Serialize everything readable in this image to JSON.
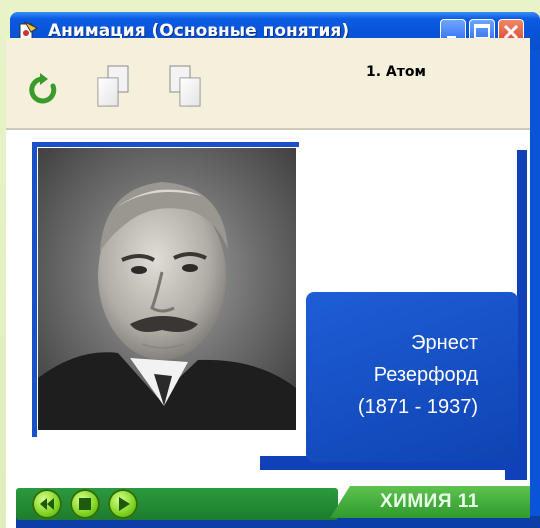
{
  "window": {
    "title": "Анимация (Основные понятия)"
  },
  "toolbar": {
    "slide_title": "1. Атом",
    "buttons": [
      {
        "icon": "refresh-icon"
      },
      {
        "icon": "page-left-icon"
      },
      {
        "icon": "page-right-icon"
      }
    ]
  },
  "slide": {
    "caption_lines": [
      "Эрнест",
      "Резерфорд",
      "(1871 - 1937)"
    ]
  },
  "footer": {
    "nav_buttons": [
      "rewind-icon",
      "stop-icon",
      "play-icon"
    ],
    "brand": "ХИМИЯ 11"
  },
  "colors": {
    "titlebar_blue": "#0853d6",
    "accent_blue": "#1a50c8",
    "caption_box": "#1e5ed6",
    "nav_green": "#2b9a3e",
    "toolbar_bg": "#f5f0dc"
  }
}
